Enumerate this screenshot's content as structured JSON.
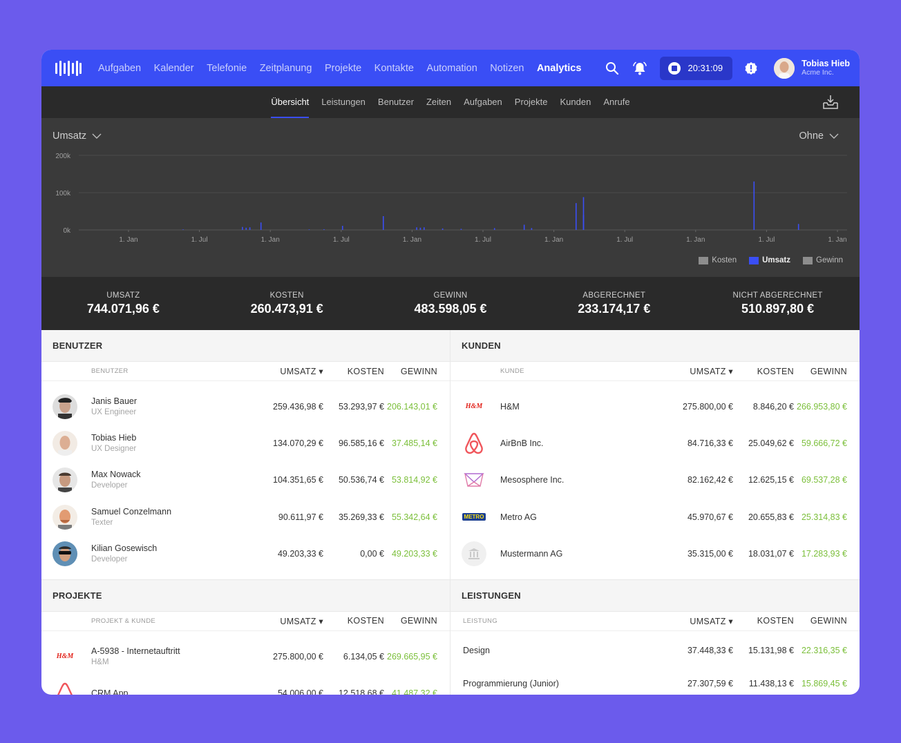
{
  "nav": {
    "items": [
      "Aufgaben",
      "Kalender",
      "Telefonie",
      "Zeitplanung",
      "Projekte",
      "Kontakte",
      "Automation",
      "Notizen",
      "Analytics"
    ],
    "active": "Analytics",
    "timer": "20:31:09",
    "user_name": "Tobias Hieb",
    "user_company": "Acme Inc."
  },
  "subnav": {
    "items": [
      "Übersicht",
      "Leistungen",
      "Benutzer",
      "Zeiten",
      "Aufgaben",
      "Projekte",
      "Kunden",
      "Anrufe"
    ],
    "active": "Übersicht"
  },
  "chart": {
    "metric_select": "Umsatz",
    "grouping_select": "Ohne",
    "legend": [
      "Kosten",
      "Umsatz",
      "Gewinn"
    ]
  },
  "chart_data": {
    "type": "bar",
    "ylim": [
      0,
      200000
    ],
    "yticks": [
      "200k",
      "100k",
      "0k"
    ],
    "xticks": [
      "1. Jan",
      "1. Jul",
      "1. Jan",
      "1. Jul",
      "1. Jan",
      "1. Jul",
      "1. Jan",
      "1. Jul",
      "1. Jan",
      "1. Jul",
      "1. Jan"
    ],
    "series": [
      {
        "name": "Umsatz",
        "color": "#3a4ef5",
        "points": [
          [
            0.14,
            1500
          ],
          [
            0.22,
            8000
          ],
          [
            0.225,
            6000
          ],
          [
            0.23,
            7000
          ],
          [
            0.245,
            20000
          ],
          [
            0.31,
            1500
          ],
          [
            0.33,
            2000
          ],
          [
            0.355,
            11000
          ],
          [
            0.41,
            37000
          ],
          [
            0.455,
            7000
          ],
          [
            0.46,
            6000
          ],
          [
            0.465,
            7000
          ],
          [
            0.49,
            4000
          ],
          [
            0.515,
            3000
          ],
          [
            0.56,
            5000
          ],
          [
            0.6,
            14000
          ],
          [
            0.61,
            5000
          ],
          [
            0.67,
            72000
          ],
          [
            0.68,
            88000
          ],
          [
            0.68,
            40000
          ],
          [
            0.91,
            130000
          ],
          [
            0.97,
            16000
          ]
        ]
      }
    ]
  },
  "totals": [
    {
      "label": "UMSATZ",
      "value": "744.071,96 €"
    },
    {
      "label": "KOSTEN",
      "value": "260.473,91 €"
    },
    {
      "label": "GEWINN",
      "value": "483.598,05 €"
    },
    {
      "label": "ABGERECHNET",
      "value": "233.174,17 €"
    },
    {
      "label": "NICHT ABGERECHNET",
      "value": "510.897,80 €"
    }
  ],
  "benutzer": {
    "title": "BENUTZER",
    "headers": [
      "BENUTZER",
      "UMSATZ ▾",
      "KOSTEN",
      "GEWINN"
    ],
    "rows": [
      {
        "name": "Janis Bauer",
        "role": "UX Engineer",
        "umsatz": "259.436,98 €",
        "kosten": "53.293,97 €",
        "gewinn": "206.143,01 €",
        "avatar": "#6d5a4c"
      },
      {
        "name": "Tobias Hieb",
        "role": "UX Designer",
        "umsatz": "134.070,29 €",
        "kosten": "96.585,16 €",
        "gewinn": "37.485,14 €",
        "avatar": "#c99f86"
      },
      {
        "name": "Max Nowack",
        "role": "Developer",
        "umsatz": "104.351,65 €",
        "kosten": "50.536,74 €",
        "gewinn": "53.814,92 €",
        "avatar": "#8f6f5d"
      },
      {
        "name": "Samuel Conzelmann",
        "role": "Texter",
        "umsatz": "90.611,97 €",
        "kosten": "35.269,33 €",
        "gewinn": "55.342,64 €",
        "avatar": "#d79772"
      },
      {
        "name": "Kilian Gosewisch",
        "role": "Developer",
        "umsatz": "49.203,33 €",
        "kosten": "0,00 €",
        "gewinn": "49.203,33 €",
        "avatar": "#3f6c8f"
      }
    ]
  },
  "kunden": {
    "title": "KUNDEN",
    "headers": [
      "KUNDE",
      "UMSATZ ▾",
      "KOSTEN",
      "GEWINN"
    ],
    "rows": [
      {
        "name": "H&M",
        "logo": "hm-logo",
        "umsatz": "275.800,00 €",
        "kosten": "8.846,20 €",
        "gewinn": "266.953,80 €"
      },
      {
        "name": "AirBnB Inc.",
        "logo": "airbnb-logo",
        "umsatz": "84.716,33 €",
        "kosten": "25.049,62 €",
        "gewinn": "59.666,72 €"
      },
      {
        "name": "Mesosphere Inc.",
        "logo": "mesosphere-logo",
        "umsatz": "82.162,42 €",
        "kosten": "12.625,15 €",
        "gewinn": "69.537,28 €"
      },
      {
        "name": "Metro AG",
        "logo": "metro-logo",
        "umsatz": "45.970,67 €",
        "kosten": "20.655,83 €",
        "gewinn": "25.314,83 €"
      },
      {
        "name": "Mustermann AG",
        "logo": "bank-icon",
        "umsatz": "35.315,00 €",
        "kosten": "18.031,07 €",
        "gewinn": "17.283,93 €"
      }
    ],
    "hm_text": "H&M",
    "metro_text": "METRO"
  },
  "projekte": {
    "title": "PROJEKTE",
    "headers": [
      "PROJEKT & KUNDE",
      "UMSATZ ▾",
      "KOSTEN",
      "GEWINN"
    ],
    "rows": [
      {
        "name": "A-5938 - Internetauftritt",
        "customer": "H&M",
        "umsatz": "275.800,00 €",
        "kosten": "6.134,05 €",
        "gewinn": "269.665,95 €"
      },
      {
        "name": "CRM App",
        "customer": "",
        "umsatz": "54.006,00 €",
        "kosten": "12.518,68 €",
        "gewinn": "41.487,32 €"
      }
    ]
  },
  "leistungen": {
    "title": "LEISTUNGEN",
    "headers": [
      "LEISTUNG",
      "UMSATZ ▾",
      "KOSTEN",
      "GEWINN"
    ],
    "rows": [
      {
        "name": "Design",
        "umsatz": "37.448,33 €",
        "kosten": "15.131,98 €",
        "gewinn": "22.316,35 €"
      },
      {
        "name": "Programmierung (Junior)",
        "umsatz": "27.307,59 €",
        "kosten": "11.438,13 €",
        "gewinn": "15.869,45 €"
      }
    ]
  }
}
